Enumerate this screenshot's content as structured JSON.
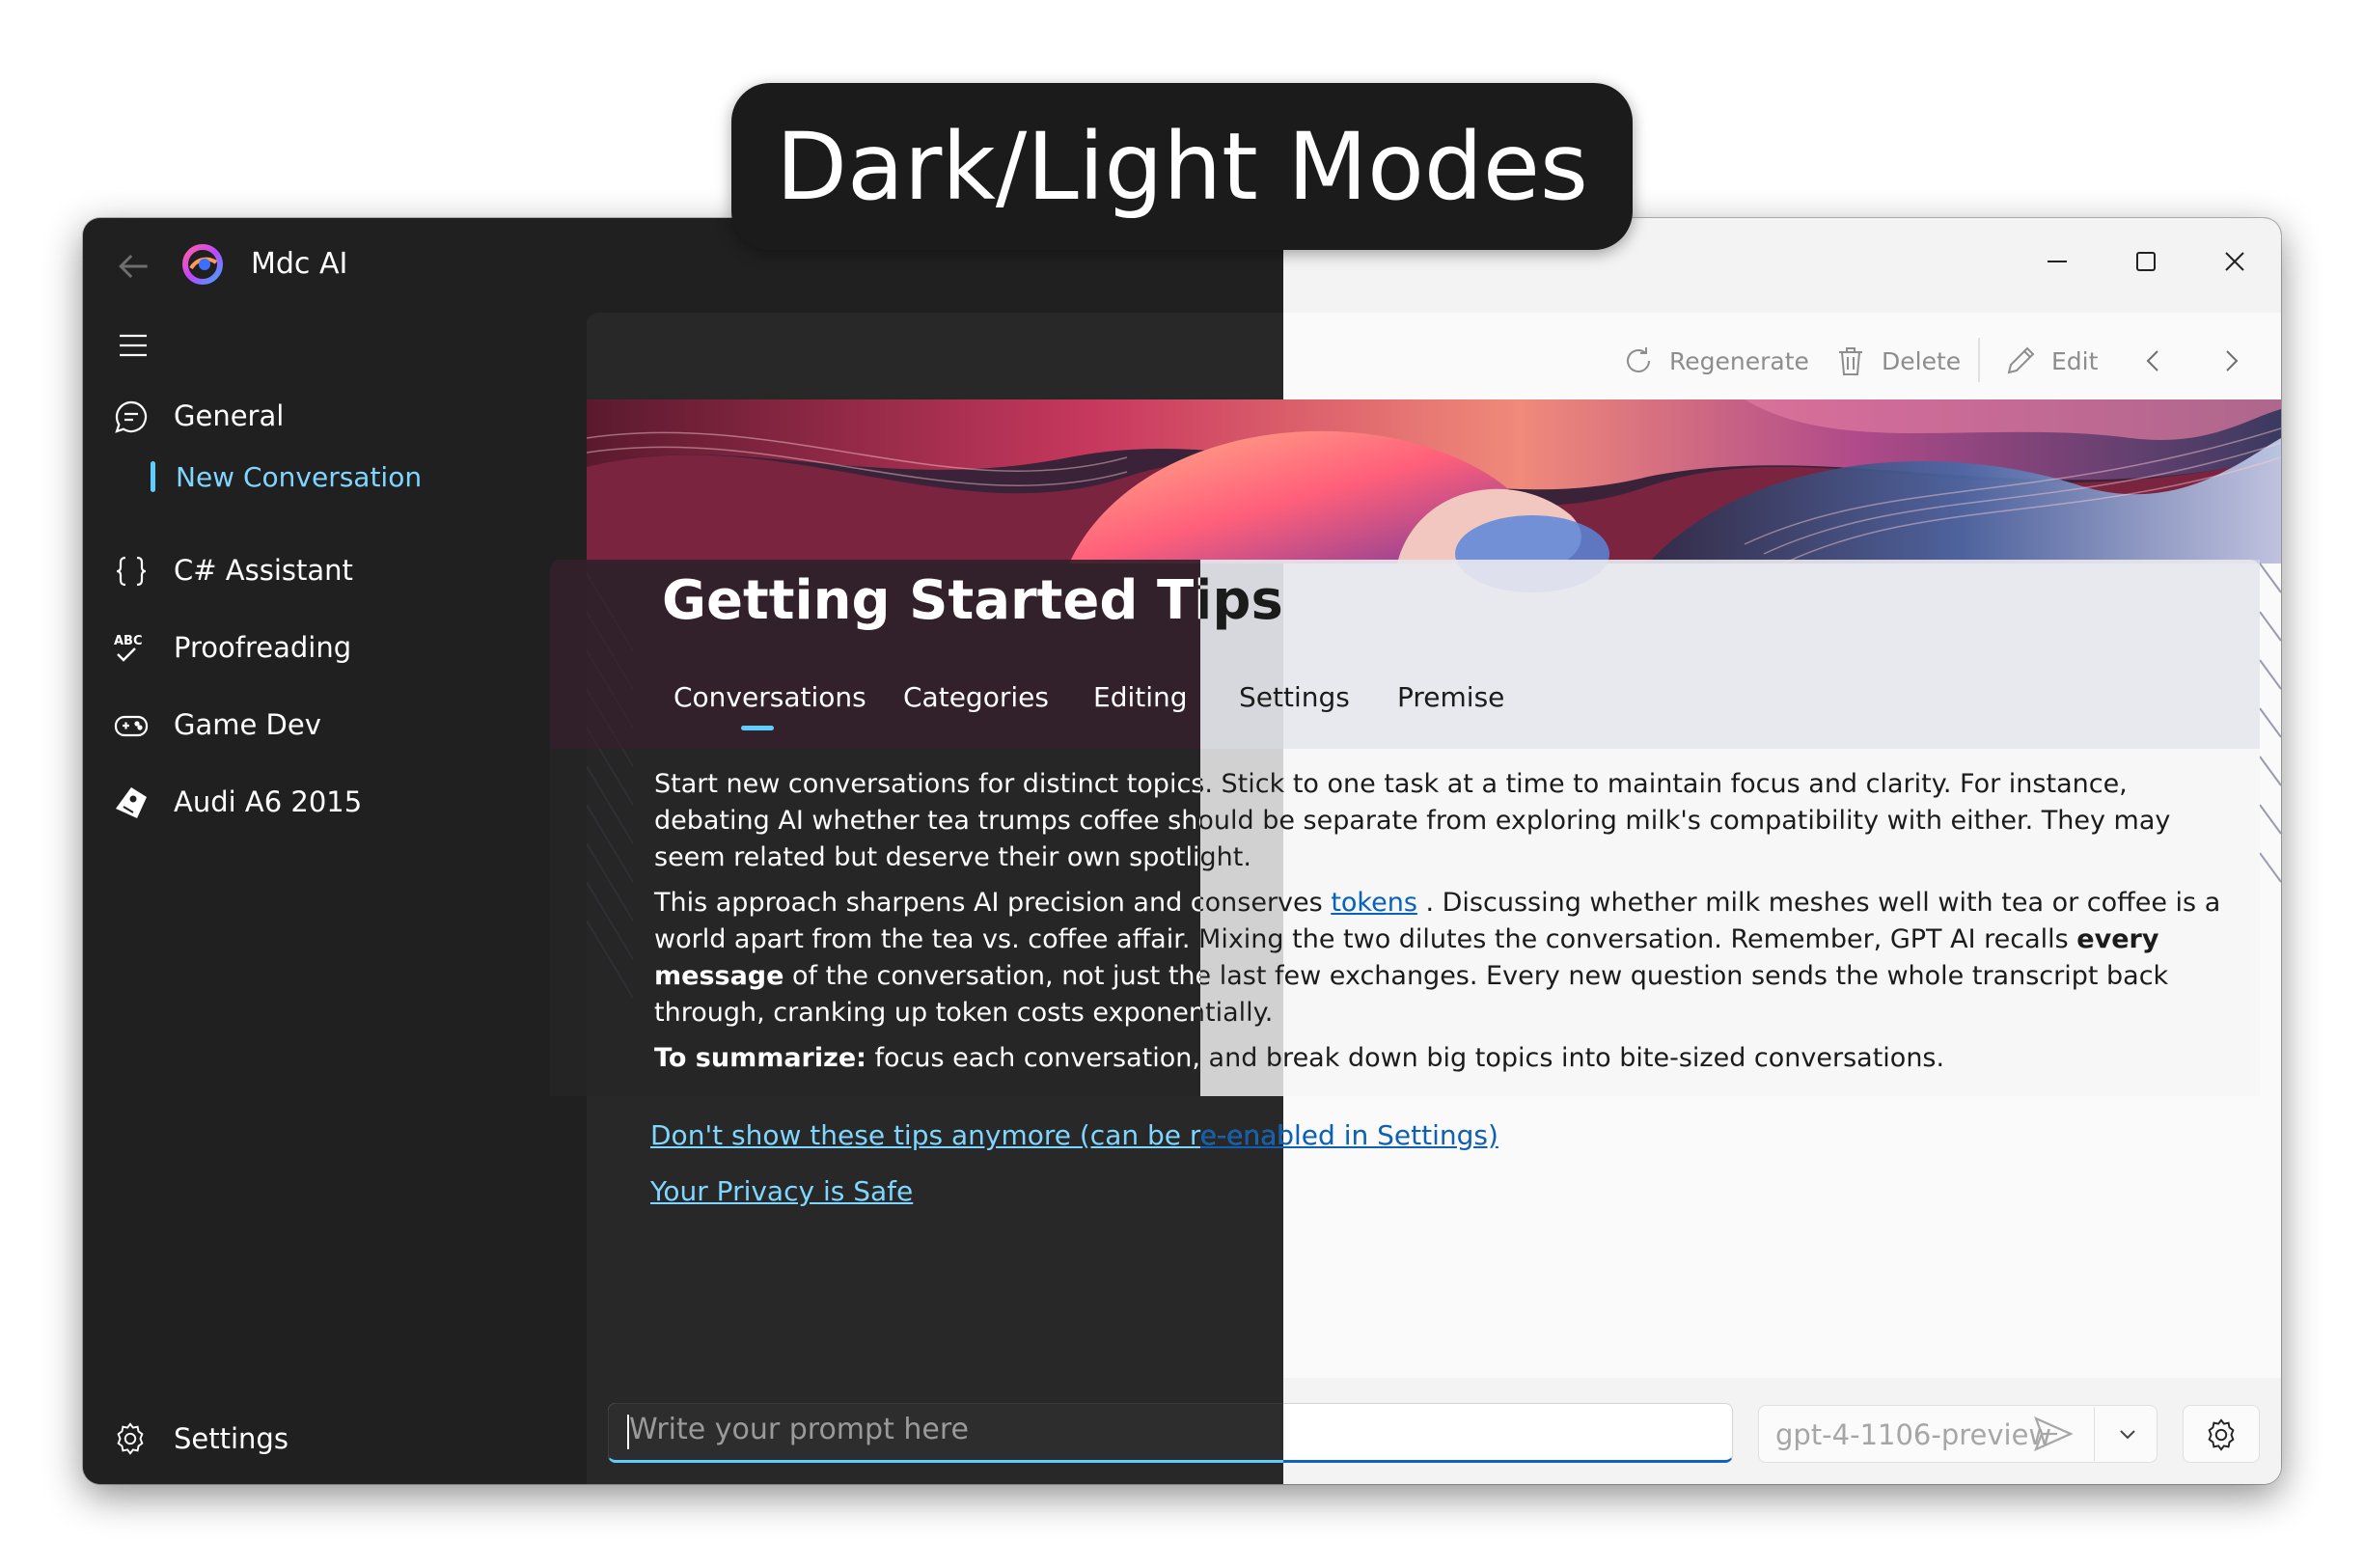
{
  "banner": {
    "title": "Dark/Light Modes"
  },
  "window": {
    "app_title": "Mdc AI",
    "controls": [
      "minimize",
      "maximize",
      "close"
    ]
  },
  "sidebar": {
    "items": [
      {
        "label": "General",
        "icon": "chat-bubble-icon",
        "expanded": true
      },
      {
        "label": "C# Assistant",
        "icon": "braces-icon",
        "expanded": false
      },
      {
        "label": "Proofreading",
        "icon": "abc-check-icon",
        "expanded": false
      },
      {
        "label": "Game Dev",
        "icon": "gamepad-icon",
        "expanded": false
      },
      {
        "label": "Audi A6 2015",
        "icon": "tag-icon",
        "expanded": false
      }
    ],
    "sub_items": [
      {
        "label": "New Conversation",
        "selected": true
      }
    ],
    "settings_label": "Settings"
  },
  "toolbar": {
    "regenerate": "Regenerate",
    "delete": "Delete",
    "edit": "Edit"
  },
  "tips": {
    "title": "Getting Started Tips",
    "tabs": [
      "Conversations",
      "Categories",
      "Editing",
      "Settings",
      "Premise"
    ],
    "active_tab": "Conversations",
    "p1": "Start new conversations for distinct topics. Stick to one task at a time to maintain focus and clarity. For instance, debating AI whether tea trumps coffee should be separate from exploring milk's compatibility with either. They may seem related but deserve their own spotlight.",
    "p2_a": "This approach sharpens AI precision and conserves ",
    "p2_link": "tokens",
    "p2_b": " . Discussing whether milk meshes well with tea or coffee is a world apart from the tea vs. coffee affair. Mixing the two dilutes the conversation. Remember, GPT AI recalls ",
    "p2_bold": "every message",
    "p2_c": " of the conversation, not just the last few exchanges. Every new question sends the whole transcript back through, cranking up token costs exponentially.",
    "p3_bold": "To summarize:",
    "p3_rest": " focus each conversation, and break down big topics into bite-sized conversations."
  },
  "links": {
    "hide_tips": "Don't show these tips anymore (can be re-enabled in Settings)",
    "privacy": "Your Privacy is Safe"
  },
  "prompt": {
    "placeholder": "Write your prompt here",
    "model": "gpt-4-1106-preview"
  },
  "colors": {
    "dark_bg": "#202020",
    "light_bg": "#f3f3f3",
    "accent_dark": "#60cdff",
    "accent_light": "#0f62c0"
  }
}
